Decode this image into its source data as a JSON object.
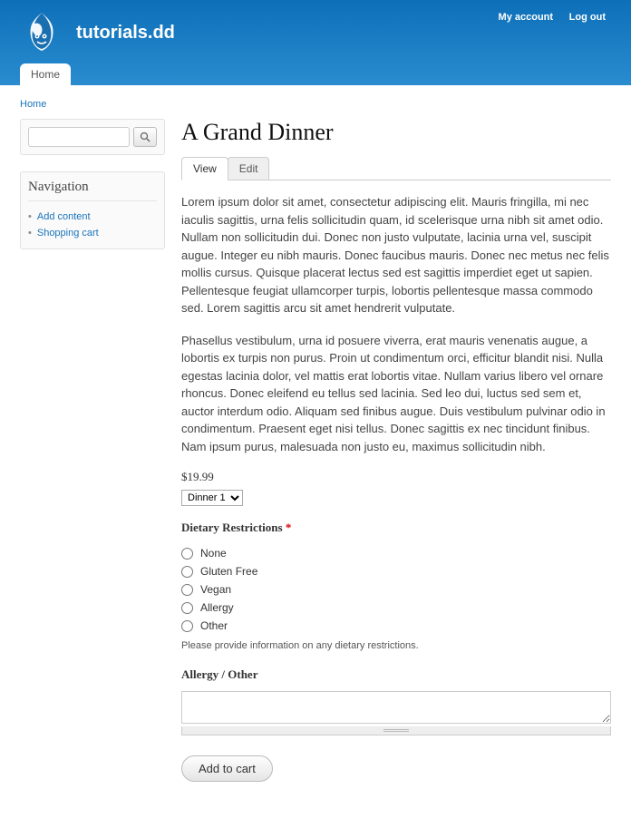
{
  "header": {
    "site_name": "tutorials.dd",
    "user_links": {
      "my_account": "My account",
      "logout": "Log out"
    },
    "nav_tab": "Home"
  },
  "breadcrumb": {
    "home": "Home"
  },
  "sidebar": {
    "search": {
      "placeholder": ""
    },
    "nav": {
      "title": "Navigation",
      "items": [
        {
          "label": "Add content"
        },
        {
          "label": "Shopping cart"
        }
      ]
    }
  },
  "main": {
    "title": "A Grand Dinner",
    "tabs": [
      {
        "label": "View",
        "active": true
      },
      {
        "label": "Edit",
        "active": false
      }
    ],
    "para1": "Lorem ipsum dolor sit amet, consectetur adipiscing elit. Mauris fringilla, mi nec iaculis sagittis, urna felis sollicitudin quam, id scelerisque urna nibh sit amet odio. Nullam non sollicitudin dui. Donec non justo vulputate, lacinia urna vel, suscipit augue. Integer eu nibh mauris. Donec faucibus mauris. Donec nec metus nec felis mollis cursus. Quisque placerat lectus sed est sagittis imperdiet eget ut sapien. Pellentesque feugiat ullamcorper turpis, lobortis pellentesque massa commodo sed. Lorem sagittis arcu sit amet hendrerit vulputate.",
    "para2": "Phasellus vestibulum, urna id posuere viverra, erat mauris venenatis augue, a lobortis ex turpis non purus. Proin ut condimentum orci, efficitur blandit nisi. Nulla egestas lacinia dolor, vel mattis erat lobortis vitae. Nullam varius libero vel ornare rhoncus. Donec eleifend eu tellus sed lacinia. Sed leo dui, luctus sed sem et, auctor interdum odio. Aliquam sed finibus augue. Duis vestibulum pulvinar odio in condimentum. Praesent eget nisi tellus. Donec sagittis ex nec tincidunt finibus. Nam ipsum purus, malesuada non justo eu, maximus sollicitudin nibh.",
    "price": "$19.99",
    "variant_options": [
      "Dinner 1"
    ],
    "dietary": {
      "label": "Dietary Restrictions",
      "options": [
        "None",
        "Gluten Free",
        "Vegan",
        "Allergy",
        "Other"
      ],
      "help": "Please provide information on any dietary restrictions."
    },
    "allergy_label": "Allergy / Other",
    "submit": "Add to cart"
  }
}
